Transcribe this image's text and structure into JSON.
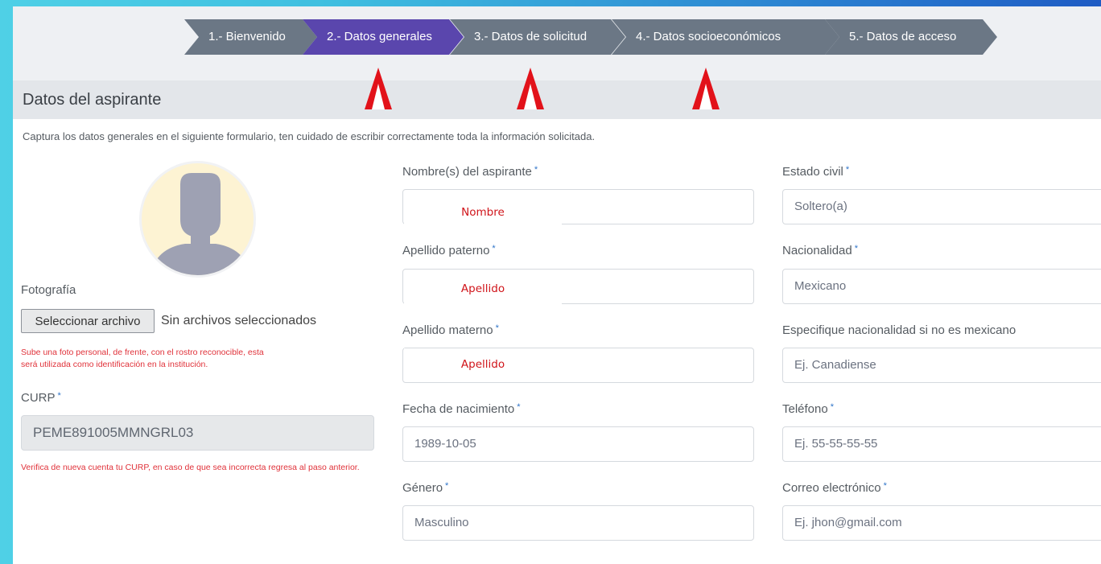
{
  "steps": [
    {
      "label": "1.- Bienvenido",
      "active": false
    },
    {
      "label": "2.- Datos generales",
      "active": true
    },
    {
      "label": "3.- Datos de solicitud",
      "active": false
    },
    {
      "label": "4.- Datos socioeconómicos",
      "active": false
    },
    {
      "label": "5.- Datos de acceso",
      "active": false
    }
  ],
  "section_title": "Datos del aspirante",
  "intro": "Captura los datos generales en el siguiente formulario, ten cuidado de escribir correctamente toda la información solicitada.",
  "photo": {
    "label": "Fotografía",
    "button": "Seleccionar archivo",
    "status": "Sin archivos seleccionados",
    "hint": "Sube una foto personal, de frente, con el rostro reconocible, esta será utilizada como identificación en la institución."
  },
  "curp": {
    "label": "CURP",
    "value": "PEME891005MMNGRL03",
    "hint": "Verifica de nueva cuenta tu CURP, en caso de que sea incorrecta regresa al paso anterior."
  },
  "required_mark": "*",
  "fields": {
    "nombre": {
      "label": "Nombre(s) del aspirante",
      "overlay": "Nombre"
    },
    "apellido_paterno": {
      "label": "Apellido paterno",
      "overlay": "Apellido"
    },
    "apellido_materno": {
      "label": "Apellido materno",
      "overlay": "Apellido"
    },
    "fecha": {
      "label": "Fecha de nacimiento",
      "value": "1989-10-05"
    },
    "genero": {
      "label": "Género",
      "value": "Masculino"
    },
    "estado_civil": {
      "label": "Estado civil",
      "value": "Soltero(a)"
    },
    "nacionalidad": {
      "label": "Nacionalidad",
      "value": "Mexicano"
    },
    "especifique": {
      "label": "Especifique nacionalidad si no es mexicano",
      "placeholder": "Ej. Canadiense"
    },
    "telefono": {
      "label": "Teléfono",
      "placeholder": "Ej. 55-55-55-55"
    },
    "correo": {
      "label": "Correo electrónico",
      "placeholder": "Ej. jhon@gmail.com"
    }
  },
  "colors": {
    "active_step": "#5a46ad",
    "step": "#6b7785",
    "annotation_red": "#e2121a",
    "required": "#2f74c8"
  }
}
